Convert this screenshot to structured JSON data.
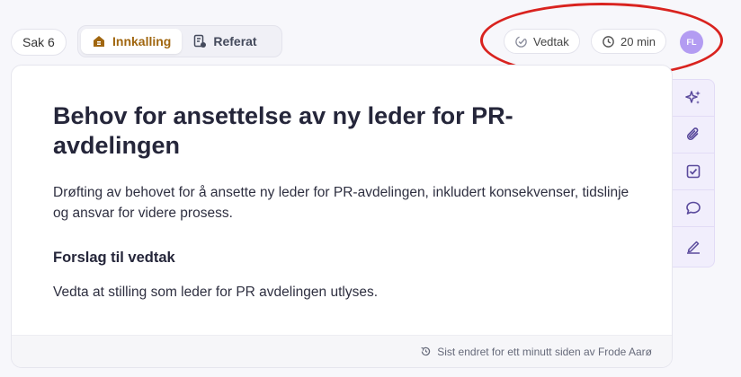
{
  "header": {
    "case_label": "Sak 6",
    "tabs": [
      {
        "label": "Innkalling",
        "icon": "home-package-icon",
        "active": true
      },
      {
        "label": "Referat",
        "icon": "document-edit-icon",
        "active": false
      }
    ],
    "decision_chip": {
      "label": "Vedtak",
      "icon": "target-check-icon"
    },
    "duration_chip": {
      "label": "20 min",
      "icon": "clock-icon"
    },
    "avatar_initials": "FL"
  },
  "content": {
    "title": "Behov for ansettelse av ny leder for PR-avdelingen",
    "description": "Drøfting av behovet for å ansette ny leder for PR-avdelingen, inkludert konsekvenser, tidslinje og ansvar for videre prosess.",
    "proposal_heading": "Forslag til vedtak",
    "proposal_text": "Vedta at stilling som leder for PR avdelingen utlyses.",
    "footer_text": "Sist endret for ett minutt siden av Frode Aarø"
  },
  "toolbar": {
    "tools": [
      "sparkles-icon",
      "paperclip-icon",
      "checkbox-icon",
      "comment-icon",
      "signature-icon"
    ]
  },
  "colors": {
    "accent": "#a0660f",
    "toolbar_bg": "#f1eefc",
    "avatar": "#b39cf2",
    "highlight": "#d9231f",
    "tool_icon": "#5a4a9c"
  }
}
